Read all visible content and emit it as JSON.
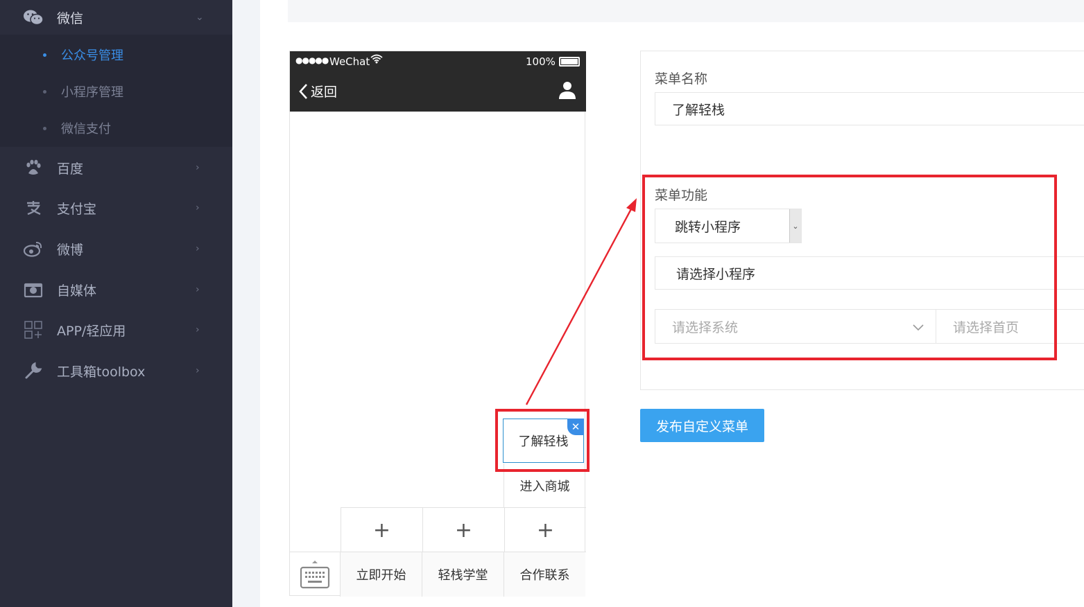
{
  "sidebar": {
    "wechat": {
      "label": "微信",
      "subitems": [
        {
          "label": "公众号管理",
          "active": true
        },
        {
          "label": "小程序管理",
          "active": false
        },
        {
          "label": "微信支付",
          "active": false
        }
      ]
    },
    "items": [
      {
        "label": "百度",
        "icon": "paw-icon"
      },
      {
        "label": "支付宝",
        "icon": "alipay-icon"
      },
      {
        "label": "微博",
        "icon": "weibo-icon"
      },
      {
        "label": "自媒体",
        "icon": "camera-icon"
      },
      {
        "label": "APP/轻应用",
        "icon": "grid-apps-icon"
      },
      {
        "label": "工具箱toolbox",
        "icon": "wrench-icon"
      }
    ]
  },
  "phone": {
    "status": {
      "carrier": "WeChat",
      "battery": "100%"
    },
    "nav": {
      "back_label": "返回"
    },
    "menu": {
      "buttons": [
        "立即开始",
        "轻栈学堂",
        "合作联系"
      ],
      "plus": [
        "+",
        "+",
        "+"
      ],
      "submenu_active": "了解轻栈",
      "submenu_other": "进入商城"
    }
  },
  "form": {
    "menu_name_label": "菜单名称",
    "menu_name_value": "了解轻栈",
    "menu_function_label": "菜单功能",
    "function_select_value": "跳转小程序",
    "miniprogram_placeholder": "请选择小程序",
    "system_placeholder": "请选择系统",
    "home_placeholder": "请选择首页"
  },
  "actions": {
    "publish_label": "发布自定义菜单"
  },
  "colors": {
    "accent": "#3a8ee6",
    "highlight": "#e8242e",
    "sidebar_bg": "#2b2d3c",
    "button": "#3aa3ef"
  }
}
